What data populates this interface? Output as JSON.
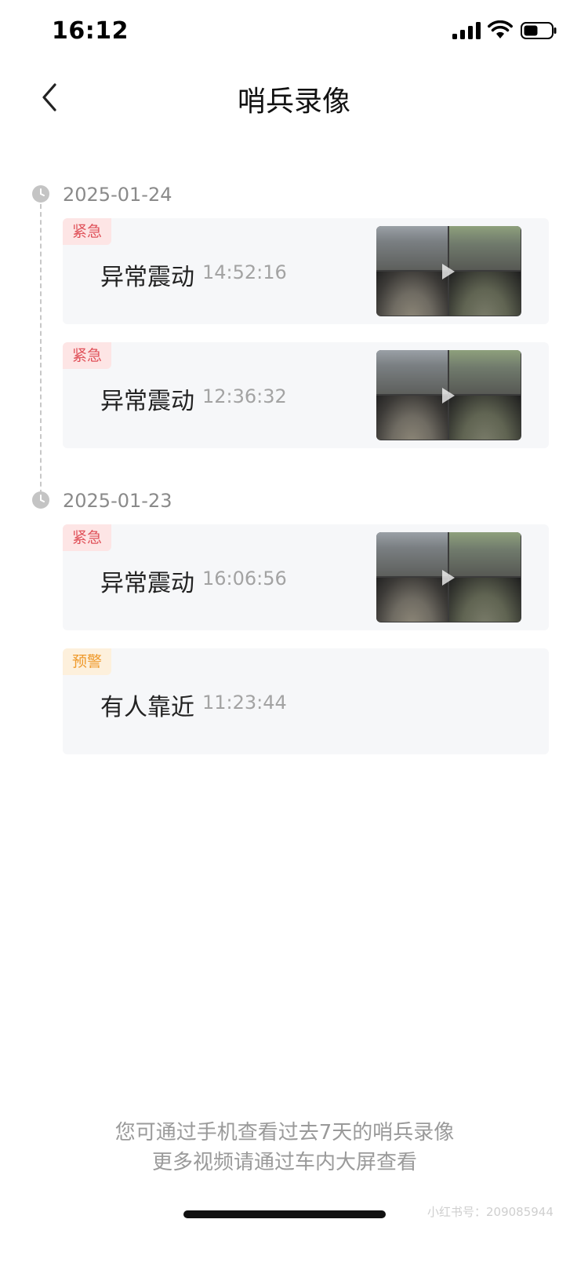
{
  "status_bar": {
    "time": "16:12"
  },
  "nav": {
    "title": "哨兵录像"
  },
  "groups": [
    {
      "date": "2025-01-24",
      "events": [
        {
          "tag": "紧急",
          "tag_type": "urgent",
          "name": "异常震动",
          "time": "14:52:16",
          "has_thumbnail": true
        },
        {
          "tag": "紧急",
          "tag_type": "urgent",
          "name": "异常震动",
          "time": "12:36:32",
          "has_thumbnail": true
        }
      ]
    },
    {
      "date": "2025-01-23",
      "events": [
        {
          "tag": "紧急",
          "tag_type": "urgent",
          "name": "异常震动",
          "time": "16:06:56",
          "has_thumbnail": true
        },
        {
          "tag": "预警",
          "tag_type": "warning",
          "name": "有人靠近",
          "time": "11:23:44",
          "has_thumbnail": false
        }
      ]
    }
  ],
  "footer": {
    "line1": "您可通过手机查看过去7天的哨兵录像",
    "line2": "更多视频请通过车内大屏查看"
  },
  "watermark": "小红书号：209085944",
  "colors": {
    "urgent": "#e0525a",
    "warning": "#ef9a2c",
    "card_bg": "#f6f7f9"
  }
}
